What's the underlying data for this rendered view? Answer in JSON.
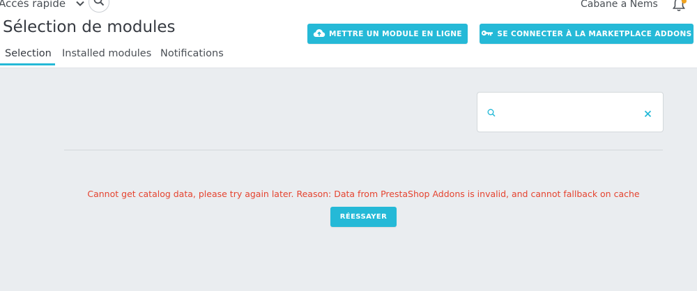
{
  "header": {
    "quick_access": "Accès rapide",
    "shop_name": "Cabane a Nems"
  },
  "page": {
    "title": "Sélection de modules"
  },
  "toolbar": {
    "upload_label": "METTRE UN MODULE EN LIGNE",
    "marketplace_label": "SE CONNECTER À LA MARKETPLACE ADDONS"
  },
  "tabs": [
    {
      "label": "Selection",
      "active": true
    },
    {
      "label": "Installed modules",
      "active": false
    },
    {
      "label": "Notifications",
      "active": false
    }
  ],
  "search": {
    "value": "",
    "placeholder": ""
  },
  "catalog": {
    "error_message": "Cannot get catalog data, please try again later. Reason: Data from PrestaShop Addons is invalid, and cannot fallback on cache",
    "retry_label": "RÉESSAYER"
  },
  "colors": {
    "accent": "#25b9d7",
    "error": "#e5432f",
    "notification_dot": "#f0a320",
    "background": "#eaedf0"
  },
  "icons": [
    "chevron-down-icon",
    "search-icon",
    "bell-icon",
    "cloud-upload-icon",
    "key-icon",
    "clear-icon"
  ]
}
